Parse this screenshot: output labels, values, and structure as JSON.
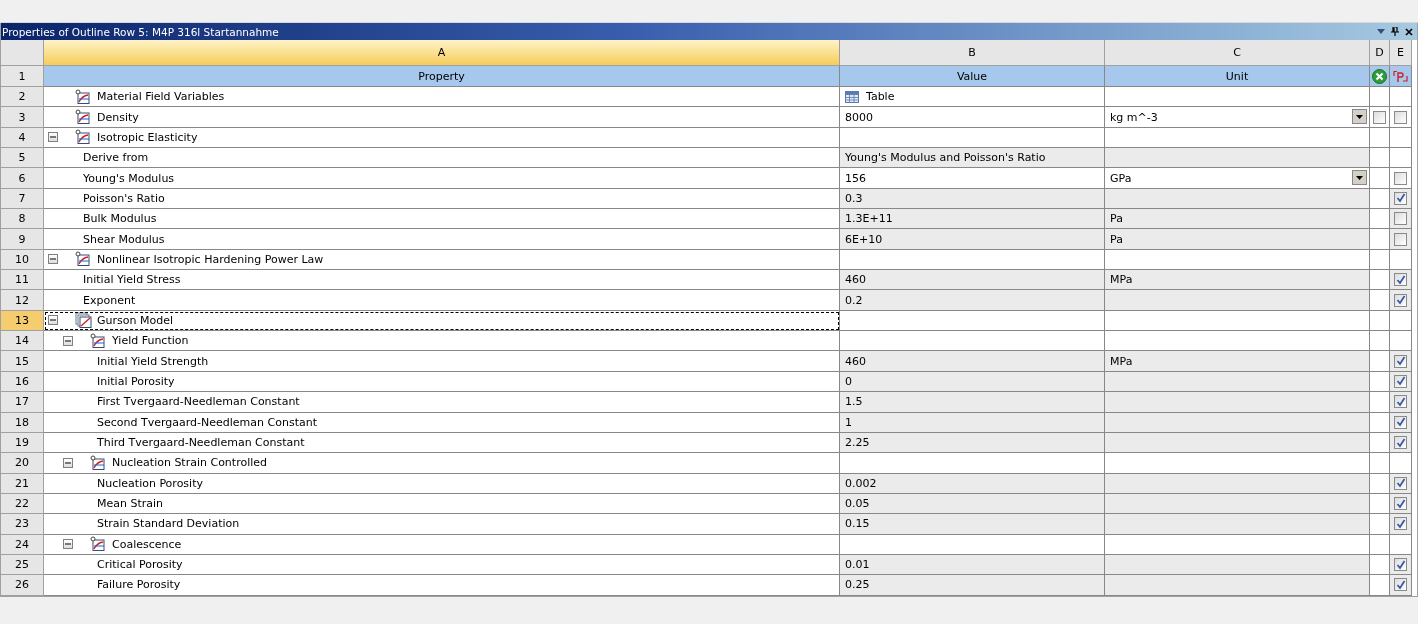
{
  "window": {
    "title": "Properties of Outline Row 5: M4P 316l Startannahme"
  },
  "columns": [
    {
      "letter": "A",
      "label": "Property",
      "selected": true
    },
    {
      "letter": "B",
      "label": "Value",
      "selected": false
    },
    {
      "letter": "C",
      "label": "Unit",
      "selected": false
    },
    {
      "letter": "D",
      "selected": false
    },
    {
      "letter": "E",
      "selected": false
    }
  ],
  "header_row_number": "1",
  "rows": [
    {
      "number": "2",
      "kind": "table",
      "label": "Material Field Variables",
      "value": "Table",
      "selected": false
    },
    {
      "number": "3",
      "kind": "group",
      "label": "Density",
      "value": "8000",
      "unit": "kg m^-3",
      "unit_dropdown": true,
      "d_check": false,
      "e_check": false,
      "selected": false
    },
    {
      "number": "4",
      "kind": "group",
      "label": "Isotropic Elasticity",
      "expanded": true,
      "selected": false,
      "children": [
        {
          "number": "5",
          "kind": "property",
          "label": "Derive from",
          "value": "Young's Modulus and Poisson's Ratio",
          "selected": false
        },
        {
          "number": "6",
          "kind": "property",
          "label": "Young's Modulus",
          "value": "156",
          "unit": "GPa",
          "unit_dropdown": true,
          "e_check": false,
          "selected": false
        },
        {
          "number": "7",
          "kind": "property",
          "label": "Poisson's Ratio",
          "value": "0.3",
          "e_check": true,
          "selected": false
        },
        {
          "number": "8",
          "kind": "property",
          "label": "Bulk Modulus",
          "value": "1.3E+11",
          "unit": "Pa",
          "e_check": false,
          "selected": false
        },
        {
          "number": "9",
          "kind": "property",
          "label": "Shear Modulus",
          "value": "6E+10",
          "unit": "Pa",
          "e_check": false,
          "selected": false
        }
      ]
    },
    {
      "number": "10",
      "kind": "group",
      "label": "Nonlinear Isotropic Hardening Power Law",
      "expanded": true,
      "selected": false,
      "children": [
        {
          "number": "11",
          "kind": "property",
          "label": "Initial Yield Stress",
          "value": "460",
          "unit": "MPa",
          "e_check": true,
          "selected": false
        },
        {
          "number": "12",
          "kind": "property",
          "label": "Exponent",
          "value": "0.2",
          "e_check": true,
          "selected": false
        }
      ]
    },
    {
      "number": "13",
      "kind": "model",
      "label": "Gurson Model",
      "expanded": true,
      "selected": true,
      "children": [
        {
          "number": "14",
          "kind": "group",
          "label": "Yield Function",
          "expanded": true,
          "selected": false,
          "children": [
            {
              "number": "15",
              "kind": "property",
              "label": "Initial Yield Strength",
              "value": "460",
              "unit": "MPa",
              "e_check": true,
              "selected": false
            },
            {
              "number": "16",
              "kind": "property",
              "label": "Initial Porosity",
              "value": "0",
              "e_check": true,
              "selected": false
            },
            {
              "number": "17",
              "kind": "property",
              "label": "First Tvergaard-Needleman Constant",
              "value": "1.5",
              "e_check": true,
              "selected": false
            },
            {
              "number": "18",
              "kind": "property",
              "label": "Second Tvergaard-Needleman Constant",
              "value": "1",
              "e_check": true,
              "selected": false
            },
            {
              "number": "19",
              "kind": "property",
              "label": "Third Tvergaard-Needleman Constant",
              "value": "2.25",
              "e_check": true,
              "selected": false
            }
          ]
        },
        {
          "number": "20",
          "kind": "group",
          "label": "Nucleation Strain Controlled",
          "expanded": true,
          "selected": false,
          "children": [
            {
              "number": "21",
              "kind": "property",
              "label": "Nucleation Porosity",
              "value": "0.002",
              "e_check": true,
              "selected": false
            },
            {
              "number": "22",
              "kind": "property",
              "label": "Mean Strain",
              "value": "0.05",
              "e_check": true,
              "selected": false
            },
            {
              "number": "23",
              "kind": "property",
              "label": "Strain Standard Deviation",
              "value": "0.15",
              "e_check": true,
              "selected": false
            }
          ]
        },
        {
          "number": "24",
          "kind": "group",
          "label": "Coalescence",
          "expanded": true,
          "selected": false,
          "children": [
            {
              "number": "25",
              "kind": "property",
              "label": "Critical Porosity",
              "value": "0.01",
              "e_check": true,
              "selected": false
            },
            {
              "number": "26",
              "kind": "property",
              "label": "Failure Porosity",
              "value": "0.25",
              "e_check": true,
              "selected": false
            }
          ]
        }
      ]
    }
  ]
}
